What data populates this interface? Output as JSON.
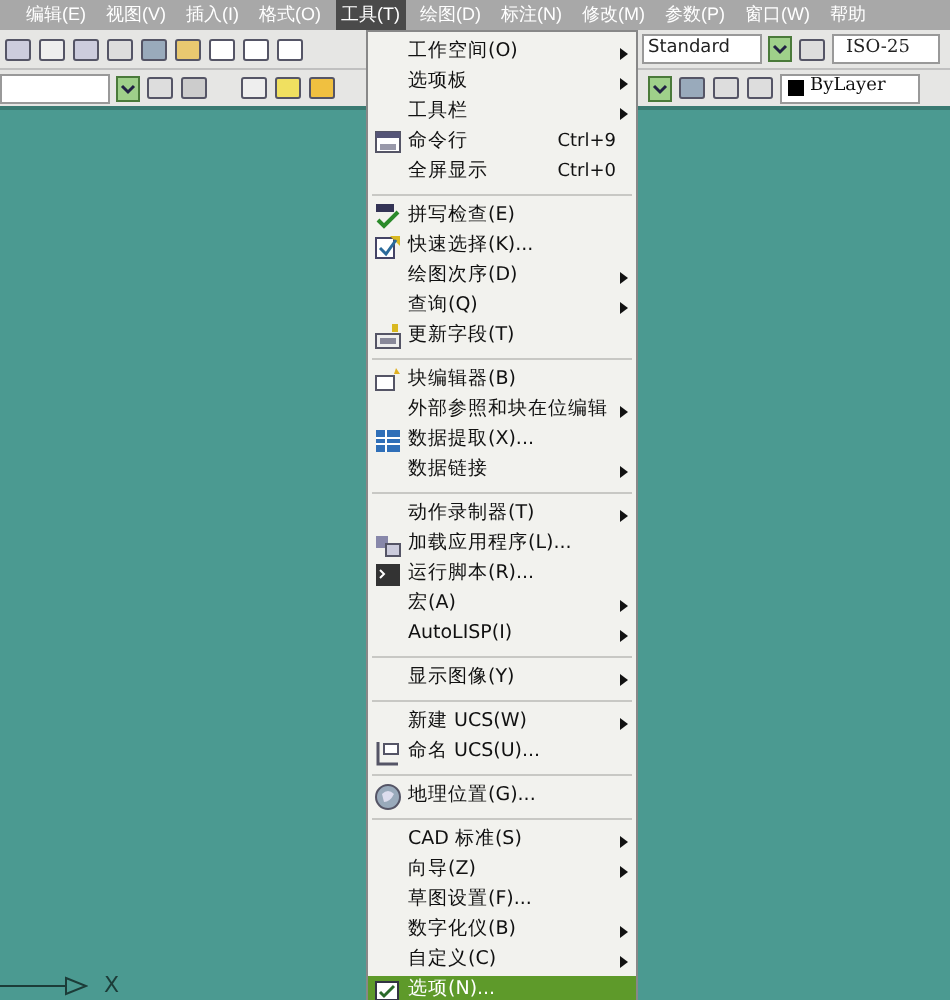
{
  "menubar": {
    "items": [
      {
        "label": "编辑(E)",
        "selected": false
      },
      {
        "label": "视图(V)",
        "selected": false
      },
      {
        "label": "插入(I)",
        "selected": false
      },
      {
        "label": "格式(O)",
        "selected": false
      },
      {
        "label": "工具(T)",
        "selected": true
      },
      {
        "label": "绘图(D)",
        "selected": false
      },
      {
        "label": "标注(N)",
        "selected": false
      },
      {
        "label": "修改(M)",
        "selected": false
      },
      {
        "label": "参数(P)",
        "selected": false
      },
      {
        "label": "窗口(W)",
        "selected": false
      },
      {
        "label": "帮助",
        "selected": false
      }
    ]
  },
  "toolbar": {
    "text_style": "Standard",
    "dim_style": "ISO-25",
    "color_control": "ByLayer"
  },
  "tools_menu": {
    "items": [
      {
        "kind": "item",
        "label": "工作空间(O)",
        "submenu": true,
        "selected": false
      },
      {
        "kind": "item",
        "label": "选项板",
        "submenu": true,
        "selected": false
      },
      {
        "kind": "item",
        "label": "工具栏",
        "submenu": true,
        "selected": false
      },
      {
        "kind": "item",
        "label": "命令行",
        "shortcut": "Ctrl+9",
        "submenu": false,
        "selected": false
      },
      {
        "kind": "item",
        "label": "全屏显示",
        "shortcut": "Ctrl+0",
        "submenu": false,
        "selected": false
      },
      {
        "kind": "separator"
      },
      {
        "kind": "item",
        "label": "拼写检查(E)",
        "submenu": false,
        "selected": false
      },
      {
        "kind": "item",
        "label": "快速选择(K)...",
        "submenu": false,
        "selected": false
      },
      {
        "kind": "item",
        "label": "绘图次序(D)",
        "submenu": true,
        "selected": false
      },
      {
        "kind": "item",
        "label": "查询(Q)",
        "submenu": true,
        "selected": false
      },
      {
        "kind": "item",
        "label": "更新字段(T)",
        "submenu": false,
        "selected": false
      },
      {
        "kind": "separator"
      },
      {
        "kind": "item",
        "label": "块编辑器(B)",
        "submenu": false,
        "selected": false
      },
      {
        "kind": "item",
        "label": "外部参照和块在位编辑",
        "submenu": true,
        "selected": false
      },
      {
        "kind": "item",
        "label": "数据提取(X)...",
        "submenu": false,
        "selected": false
      },
      {
        "kind": "item",
        "label": "数据链接",
        "submenu": true,
        "selected": false
      },
      {
        "kind": "separator"
      },
      {
        "kind": "item",
        "label": "动作录制器(T)",
        "submenu": true,
        "selected": false
      },
      {
        "kind": "item",
        "label": "加载应用程序(L)...",
        "submenu": false,
        "selected": false
      },
      {
        "kind": "item",
        "label": "运行脚本(R)...",
        "submenu": false,
        "selected": false
      },
      {
        "kind": "item",
        "label": "宏(A)",
        "submenu": true,
        "selected": false
      },
      {
        "kind": "item",
        "label": "AutoLISP(I)",
        "submenu": true,
        "selected": false
      },
      {
        "kind": "separator"
      },
      {
        "kind": "item",
        "label": "显示图像(Y)",
        "submenu": true,
        "selected": false
      },
      {
        "kind": "separator"
      },
      {
        "kind": "item",
        "label": "新建 UCS(W)",
        "submenu": true,
        "selected": false
      },
      {
        "kind": "item",
        "label": "命名 UCS(U)...",
        "submenu": false,
        "selected": false
      },
      {
        "kind": "separator"
      },
      {
        "kind": "item",
        "label": "地理位置(G)...",
        "submenu": false,
        "selected": false
      },
      {
        "kind": "separator"
      },
      {
        "kind": "item",
        "label": "CAD 标准(S)",
        "submenu": true,
        "selected": false
      },
      {
        "kind": "item",
        "label": "向导(Z)",
        "submenu": true,
        "selected": false
      },
      {
        "kind": "item",
        "label": "草图设置(F)...",
        "submenu": false,
        "selected": false
      },
      {
        "kind": "item",
        "label": "数字化仪(B)",
        "submenu": true,
        "selected": false
      },
      {
        "kind": "item",
        "label": "自定义(C)",
        "submenu": true,
        "selected": false
      },
      {
        "kind": "item",
        "label": "选项(N)...",
        "submenu": false,
        "selected": true
      }
    ]
  },
  "canvas": {
    "ucs_axis_label": "X"
  }
}
